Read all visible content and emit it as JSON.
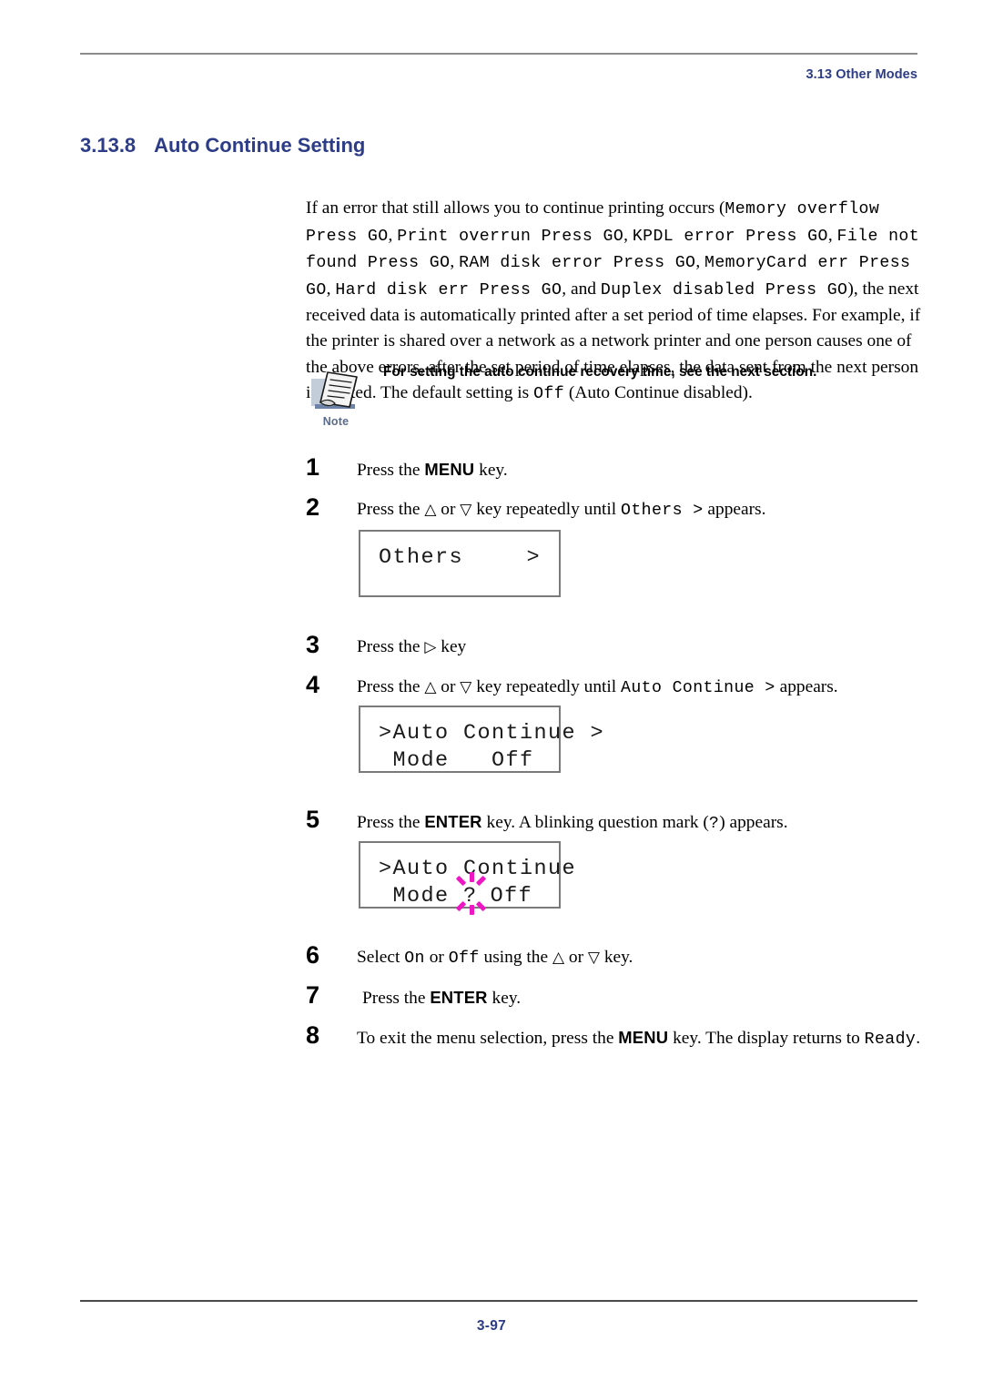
{
  "header": {
    "running_head": "3.13 Other Modes"
  },
  "section": {
    "number": "3.13.8",
    "title": "Auto Continue Setting"
  },
  "intro": {
    "p1_a": "If an error that still allows you to continue printing occurs (",
    "m1": "Memory overflow Press GO",
    "p1_b": ", ",
    "m2": "Print overrun Press GO",
    "p1_c": ", ",
    "m3": "KPDL error Press GO",
    "p1_d": ", ",
    "m4": "File not found Press GO",
    "p1_e": ", ",
    "m5": "RAM disk error Press GO",
    "p1_f": ", ",
    "m6": "MemoryCard err Press GO",
    "p1_g": ", ",
    "m7": "Hard disk err Press GO",
    "p1_h": ", and ",
    "m8": "Duplex disabled Press GO",
    "p1_i": "), the next received data is automatically printed after a set period of time elapses. For example, if the printer is shared over a network as a network printer and one person causes one of the above errors, after the set period of time elapses, the data sent from the next person is printed. The default setting is ",
    "m9": "Off",
    "p1_j": " (Auto Continue disabled)."
  },
  "note": {
    "icon_name": "note-document-icon",
    "label": "Note",
    "text": "For setting the auto continue recovery time, see the next section.",
    "label_color": "#5b6b8c"
  },
  "steps": [
    {
      "num": "1",
      "pre": "Press the ",
      "key": "MENU",
      "post": " key."
    },
    {
      "num": "2",
      "pre": "Press the ",
      "up": "△",
      "mid": " or ",
      "down": "▽",
      "post": " key repeatedly until ",
      "mono": "Others >",
      "tail": " appears."
    },
    {
      "num": "3",
      "pre": "Press the ",
      "right": "▷",
      "post": " key"
    },
    {
      "num": "4",
      "pre": "Press the ",
      "up": "△",
      "mid": " or ",
      "down": "▽",
      "post": " key repeatedly until ",
      "mono": "Auto Continue >",
      "tail": " appears."
    },
    {
      "num": "5",
      "pre": "Press the ",
      "key": "ENTER",
      "post": " key. A blinking question mark (",
      "mono": "?",
      "tail": ") appears."
    },
    {
      "num": "6",
      "pre": "Select ",
      "mono": "On",
      "mid2": " or ",
      "mono2": "Off",
      "post": " using the ",
      "up": "△",
      "mid": " or ",
      "down": "▽",
      "tail": " key."
    },
    {
      "num": "7",
      "pre": " Press the ",
      "key": "ENTER",
      "post": " key."
    },
    {
      "num": "8",
      "pre": "To exit the menu selection, press the ",
      "key": "MENU",
      "post": " key. The display returns to ",
      "mono": "Ready",
      "tail": "."
    }
  ],
  "lcd_panels": [
    {
      "name": "lcd-others",
      "line1_left": "Others",
      "line1_right": ">",
      "line2": ""
    },
    {
      "name": "lcd-auto-continue",
      "line1": ">Auto Continue >",
      "line2": " Mode   Off"
    },
    {
      "name": "lcd-auto-continue-blink",
      "line1": ">Auto Continue",
      "line2_a": " Mode ",
      "line2_blink": "?",
      "line2_b": " Off",
      "blink_color": "#ee17c4"
    }
  ],
  "footer": {
    "page_number": "3-97"
  },
  "colors": {
    "heading_navy": "#2d3c86",
    "rule_gray": "#8c8c8c",
    "rule_dark": "#4a4a4a"
  }
}
